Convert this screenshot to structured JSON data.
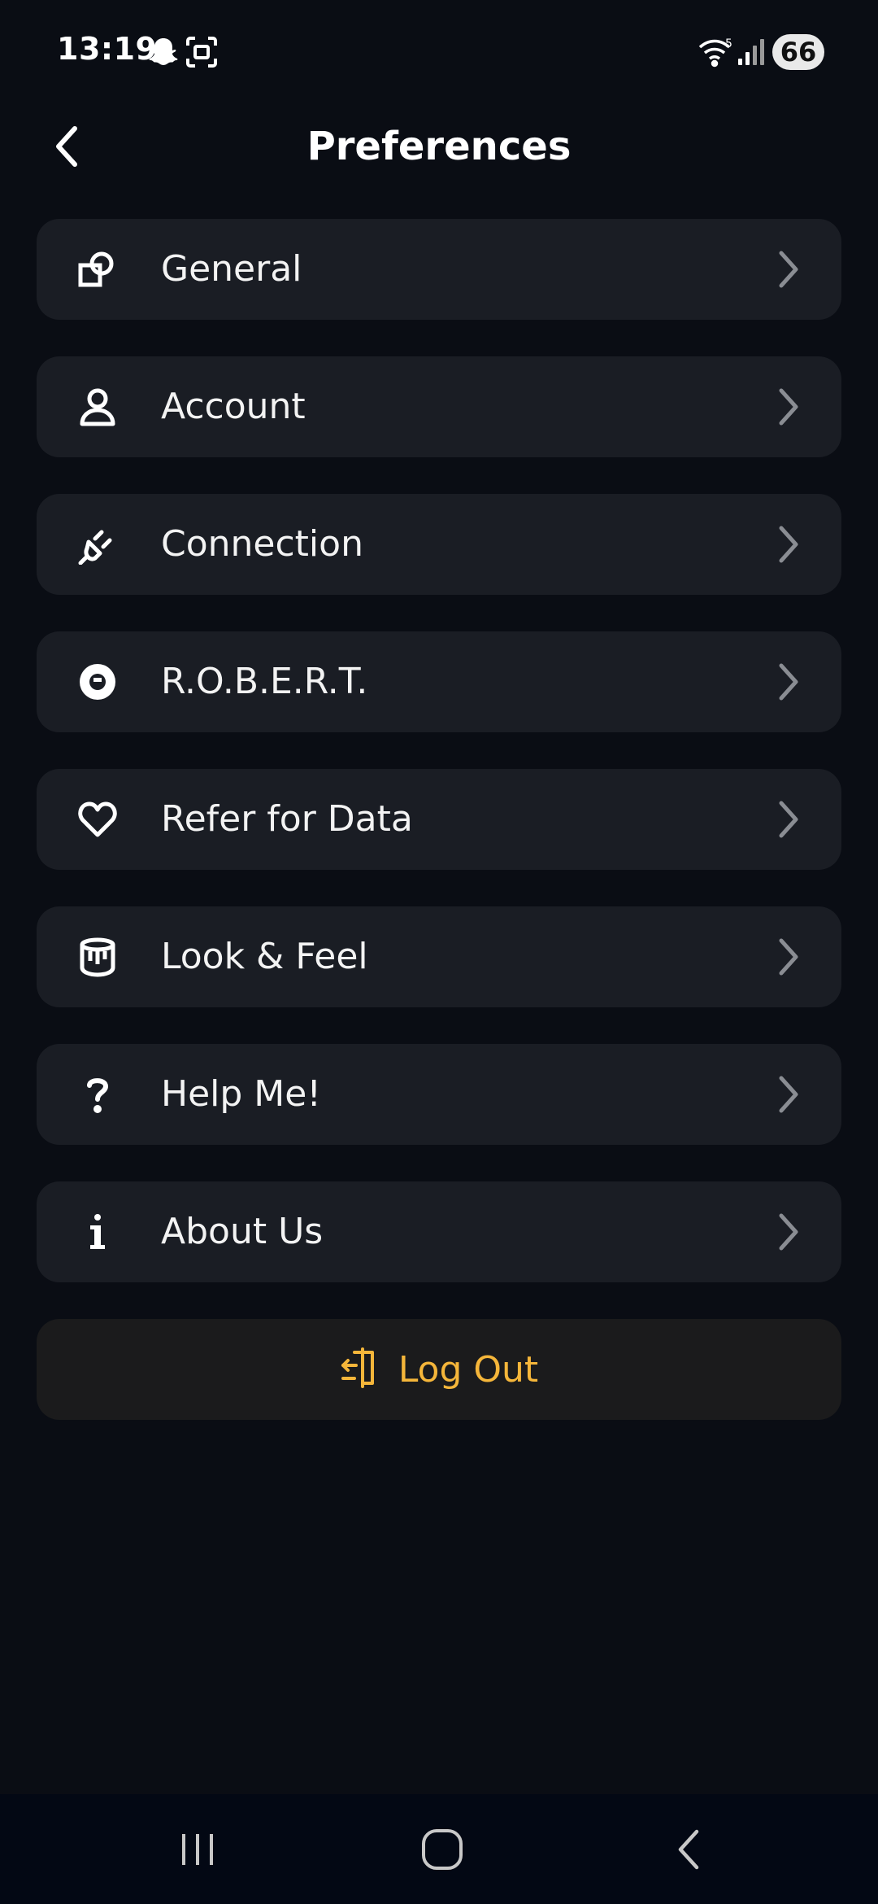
{
  "status_bar": {
    "time": "13:19",
    "battery": "66",
    "icons": [
      "snapchat-icon",
      "screen-capture-icon",
      "wifi-icon",
      "signal-icon"
    ]
  },
  "header": {
    "title": "Preferences",
    "back_icon": "chevron-left-icon"
  },
  "menu": {
    "items": [
      {
        "label": "General",
        "icon": "shapes-icon"
      },
      {
        "label": "Account",
        "icon": "user-icon"
      },
      {
        "label": "Connection",
        "icon": "plug-icon"
      },
      {
        "label": "R.O.B.E.R.T.",
        "icon": "robot-face-icon"
      },
      {
        "label": "Refer for Data",
        "icon": "heart-icon"
      },
      {
        "label": "Look & Feel",
        "icon": "paint-bucket-icon"
      },
      {
        "label": "Help Me!",
        "icon": "question-icon"
      },
      {
        "label": "About Us",
        "icon": "info-icon"
      }
    ]
  },
  "logout": {
    "label": "Log Out",
    "icon": "logout-door-icon",
    "color": "#f5b63a"
  },
  "colors": {
    "background": "#0a0d14",
    "card": "#1a1d24",
    "accent": "#f5b63a",
    "chevron": "#8a8d93"
  },
  "nav_bar": {
    "icons": [
      "recent-apps-icon",
      "home-icon",
      "back-icon"
    ]
  }
}
